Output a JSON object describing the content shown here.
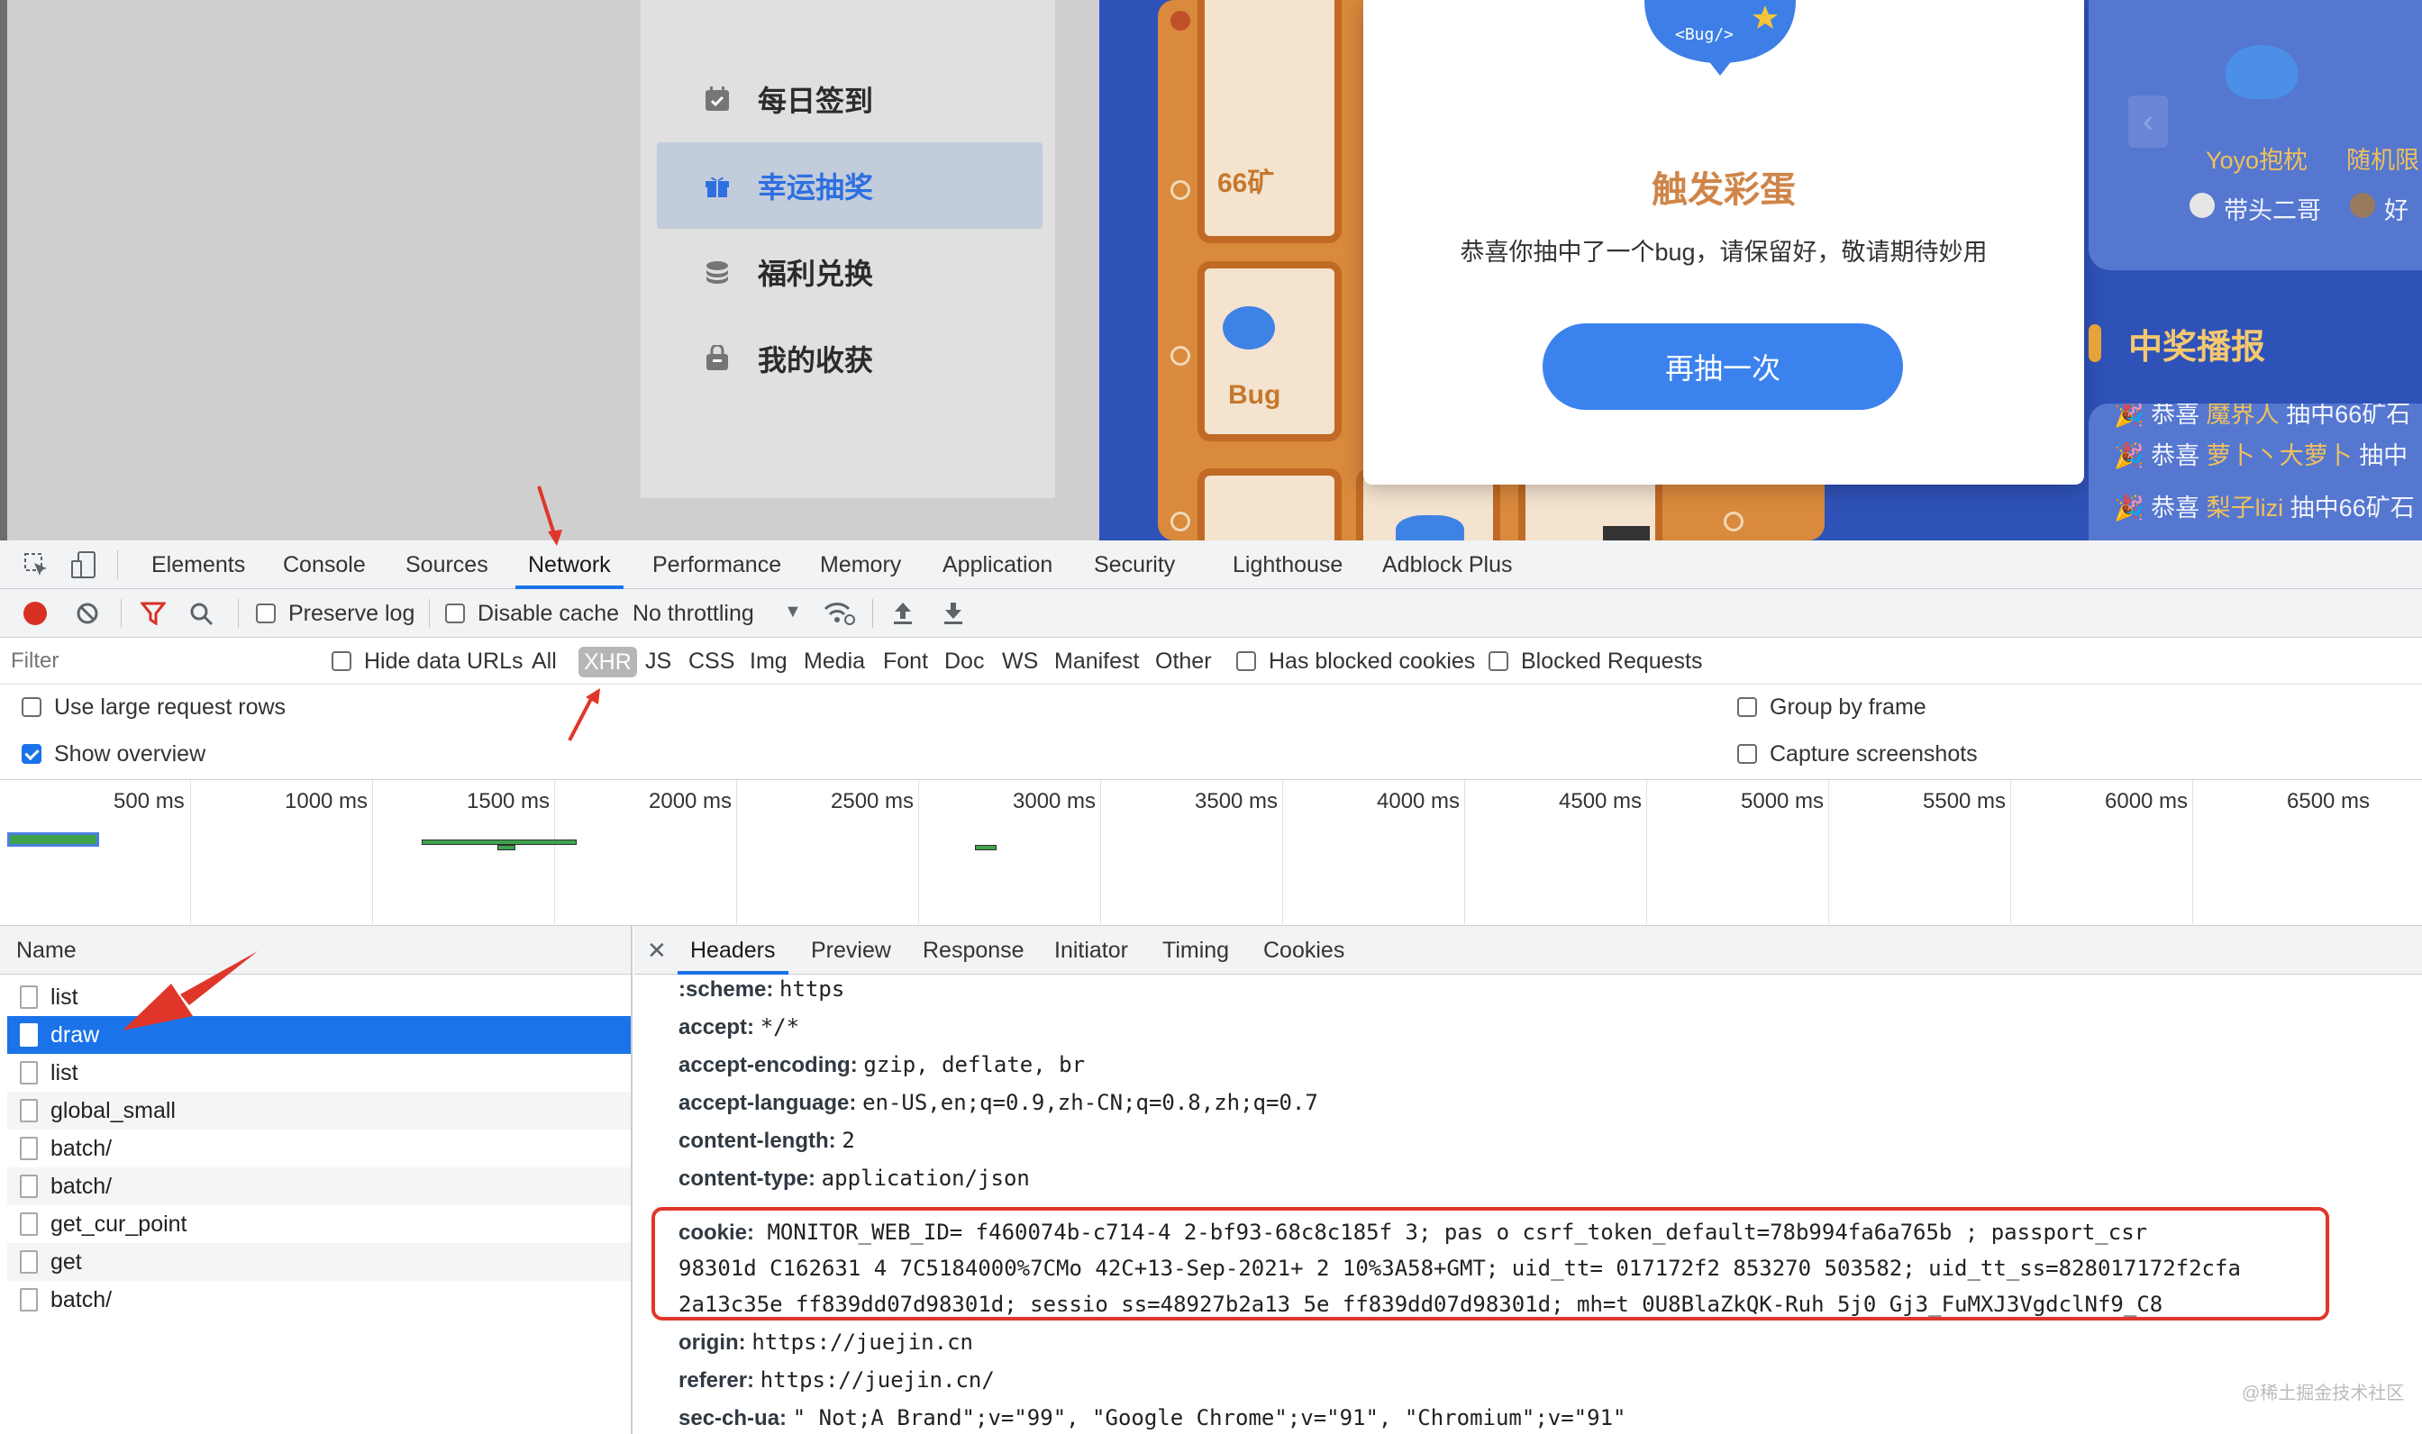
{
  "page": {
    "menu": [
      {
        "label": "每日签到",
        "icon": "calendar-check-icon",
        "active": false
      },
      {
        "label": "幸运抽奖",
        "icon": "gift-icon",
        "active": true
      },
      {
        "label": "福利兑换",
        "icon": "coins-icon",
        "active": false
      },
      {
        "label": "我的收获",
        "icon": "bag-icon",
        "active": false
      }
    ],
    "board_tiles": {
      "top_text": "66矿",
      "mid_text": "Bug"
    },
    "modal": {
      "badge_text": "<Bug/>",
      "title": "触发彩蛋",
      "message": "恭喜你抽中了一个bug，请保留好，敬请期待妙用",
      "button": "再抽一次"
    },
    "right_panel": {
      "item1": "Yoyo抱枕",
      "item2": "随机限",
      "user1": "带头二哥",
      "user2": "好"
    },
    "broadcast": {
      "title": "中奖播报",
      "lines": [
        {
          "prefix": "恭喜",
          "name": "魔界人",
          "suffix": "抽中66矿石"
        },
        {
          "prefix": "恭喜",
          "name": "萝卜丶大萝卜",
          "suffix": "抽中"
        },
        {
          "prefix": "恭喜",
          "name": "梨子lizi",
          "suffix": "抽中66矿石"
        }
      ]
    },
    "colors": {
      "accent": "#1a73e8",
      "page_blue": "#2f52b8",
      "modal_button": "#3b82ef",
      "title_orange": "#cf8548",
      "highlight_red": "#e0362a"
    }
  },
  "devtools": {
    "tabs": [
      "Elements",
      "Console",
      "Sources",
      "Network",
      "Performance",
      "Memory",
      "Application",
      "Security",
      "Lighthouse",
      "Adblock Plus"
    ],
    "active_tab": "Network",
    "toolbar": {
      "preserve_log": "Preserve log",
      "disable_cache": "Disable cache",
      "throttling": "No throttling"
    },
    "filter": {
      "placeholder": "Filter",
      "hide_data_urls": "Hide data URLs",
      "types": [
        "All",
        "XHR",
        "JS",
        "CSS",
        "Img",
        "Media",
        "Font",
        "Doc",
        "WS",
        "Manifest",
        "Other"
      ],
      "selected_type": "XHR",
      "has_blocked_cookies": "Has blocked cookies",
      "blocked_requests": "Blocked Requests"
    },
    "options": {
      "large_rows": "Use large request rows",
      "show_overview": "Show overview",
      "group_by_frame": "Group by frame",
      "capture_screenshots": "Capture screenshots"
    },
    "timeline_labels": [
      "500 ms",
      "1000 ms",
      "1500 ms",
      "2000 ms",
      "2500 ms",
      "3000 ms",
      "3500 ms",
      "4000 ms",
      "4500 ms",
      "5000 ms",
      "5500 ms",
      "6000 ms",
      "6500 ms"
    ],
    "requests_header": "Name",
    "requests": [
      "list",
      "draw",
      "list",
      "global_small",
      "batch/",
      "batch/",
      "get_cur_point",
      "get",
      "batch/"
    ],
    "selected_request": "draw",
    "detail_tabs": [
      "Headers",
      "Preview",
      "Response",
      "Initiator",
      "Timing",
      "Cookies"
    ],
    "headers": [
      {
        "k": ":scheme:",
        "v": "https"
      },
      {
        "k": "accept:",
        "v": "*/*"
      },
      {
        "k": "accept-encoding:",
        "v": "gzip, deflate, br"
      },
      {
        "k": "accept-language:",
        "v": "en-US,en;q=0.9,zh-CN;q=0.8,zh;q=0.7"
      },
      {
        "k": "content-length:",
        "v": "2"
      },
      {
        "k": "content-type:",
        "v": "application/json"
      }
    ],
    "cookie_key": "cookie:",
    "cookie_lines": [
      "MONITOR_WEB_ID=  f460074b-c714-4  2-bf93-68c8c185f  3; pas  o    csrf_token_default=78b994fa6a765b        ; passport_csr",
      "98301d  C162631  4  7C5184000%7CMo  42C+13-Sep-2021+  2  10%3A58+GMT; uid_tt=  017172f2    853270  503582; uid_tt_ss=828017172f2cfa",
      "2a13c35e  ff839dd07d98301d; sessio  ss=48927b2a13  5e  ff839dd07d98301d;    mh=t  0U8BlaZkQK-Ruh  5j0  Gj3_FuMXJ3VgdclNf9_C8"
    ],
    "headers_after": [
      {
        "k": "origin:",
        "v": "https://juejin.cn"
      },
      {
        "k": "referer:",
        "v": "https://juejin.cn/"
      },
      {
        "k": "sec-ch-ua:",
        "v": "\" Not;A Brand\";v=\"99\", \"Google Chrome\";v=\"91\", \"Chromium\";v=\"91\""
      }
    ]
  },
  "watermark": "@稀土掘金技术社区"
}
